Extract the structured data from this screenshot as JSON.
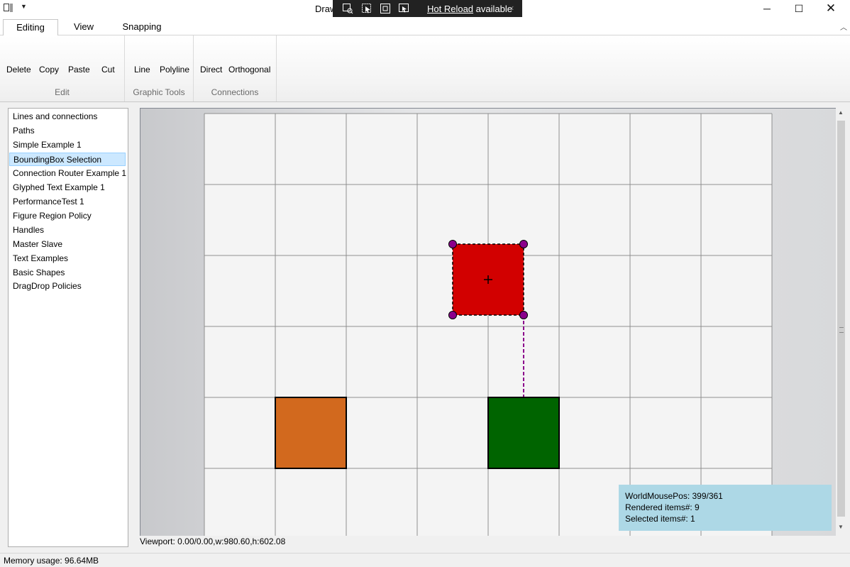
{
  "window": {
    "title": "Draw",
    "controls": {
      "minimize": "─",
      "maximize": "☐",
      "close": "✕"
    }
  },
  "hot_reload": {
    "link_text": "Hot Reload",
    "status_text": "available",
    "icons": [
      "inspect-tree-icon",
      "select-element-icon",
      "display-layout-icon",
      "track-focus-icon"
    ]
  },
  "ribbon": {
    "tabs": [
      "Editing",
      "View",
      "Snapping"
    ],
    "active_tab": "Editing",
    "groups": [
      {
        "label": "Edit",
        "buttons": [
          "Delete",
          "Copy",
          "Paste",
          "Cut"
        ]
      },
      {
        "label": "Graphic Tools",
        "buttons": [
          "Line",
          "Polyline"
        ]
      },
      {
        "label": "Connections",
        "buttons": [
          "Direct",
          "Orthogonal"
        ]
      }
    ]
  },
  "examples": {
    "items": [
      "Lines and connections",
      "Paths",
      "Simple Example 1",
      "BoundingBox Selection",
      "Connection Router Example 1",
      "Glyphed Text Example 1",
      "PerformanceTest 1",
      "Figure Region Policy",
      "Handles",
      "Master Slave",
      "Text Examples",
      "Basic Shapes",
      "DragDrop Policies"
    ],
    "selected": "BoundingBox Selection"
  },
  "canvas": {
    "grid_columns": 8,
    "grid_rows": 6,
    "shapes": [
      {
        "name": "red-square",
        "color": "#d20000",
        "selected": true
      },
      {
        "name": "orange-square",
        "color": "#d2691e",
        "selected": false
      },
      {
        "name": "green-square",
        "color": "#006400",
        "selected": false
      }
    ],
    "handle_color": "#8b008b",
    "connection_color": "#8b008b"
  },
  "info_panel": {
    "world_mouse_pos": "WorldMousePos: 399/361",
    "rendered_items": "Rendered items#: 9",
    "selected_items": "Selected items#: 1"
  },
  "viewport_label": "Viewport: 0.00/0.00,w:980.60,h:602.08",
  "status": {
    "memory": "Memory usage: 96.64MB"
  }
}
